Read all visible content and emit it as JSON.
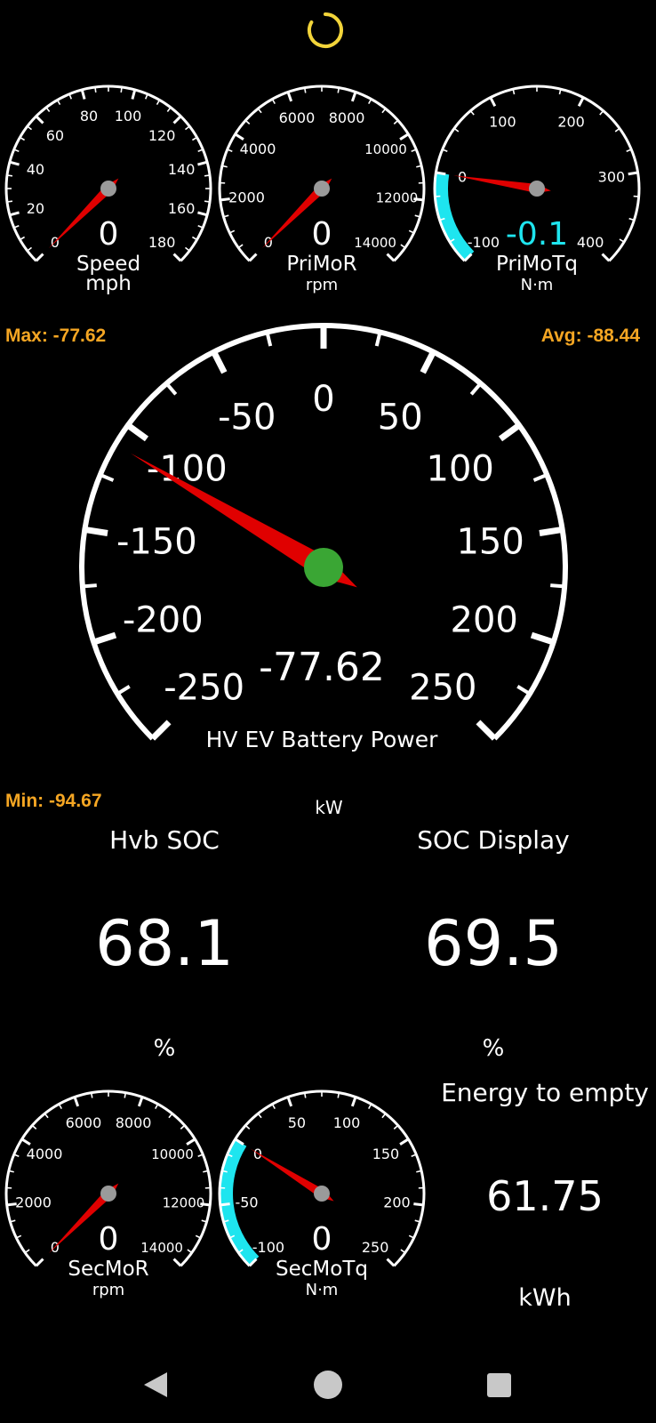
{
  "colors": {
    "needle": "#e00000",
    "hub_small": "#9a9a9a",
    "hub_big": "#3aa634",
    "accent_cyan": "#1ee5ef",
    "stats": "#f5a623",
    "spinner": "#f2d43a",
    "nav": "#c8c8c8"
  },
  "gauges_top": [
    {
      "id": "speed",
      "labels": [
        "0",
        "20",
        "40",
        "60",
        "80",
        "100",
        "120",
        "140",
        "160",
        "180"
      ],
      "min": 0,
      "max": 180,
      "value": 0,
      "value_text": "0",
      "name": "Speed",
      "unit": "mph"
    },
    {
      "id": "primor",
      "labels": [
        "0",
        "2000",
        "4000",
        "6000",
        "8000",
        "10000",
        "12000",
        "14000"
      ],
      "min": 0,
      "max": 14000,
      "value": 0,
      "value_text": "0",
      "name": "PriMoR",
      "unit": "rpm"
    },
    {
      "id": "primotq",
      "labels": [
        "-100",
        "0",
        "100",
        "200",
        "300",
        "400"
      ],
      "min": -100,
      "max": 400,
      "value": -0.1,
      "value_text": "-0.1",
      "name": "PriMoTq",
      "unit": "N·m",
      "cyan_range": [
        -100,
        0
      ]
    }
  ],
  "stats": {
    "max": "Max: -77.62",
    "avg": "Avg: -88.44",
    "min": "Min: -94.67"
  },
  "main_gauge": {
    "labels": [
      "-250",
      "-200",
      "-150",
      "-100",
      "-50",
      "0",
      "50",
      "100",
      "150",
      "200",
      "250"
    ],
    "min": -250,
    "max": 250,
    "value": -110,
    "value_text": "-77.62",
    "name": "HV EV Battery Power",
    "unit": "kW"
  },
  "tiles": {
    "hvb_soc": {
      "title": "Hvb SOC",
      "value": "68.1",
      "unit": "%"
    },
    "soc_display": {
      "title": "SOC Display",
      "value": "69.5",
      "unit": "%"
    },
    "energy": {
      "title": "Energy to empty",
      "value": "61.75",
      "unit": "kWh"
    }
  },
  "gauges_bottom": [
    {
      "id": "secmor",
      "labels": [
        "0",
        "2000",
        "4000",
        "6000",
        "8000",
        "10000",
        "12000",
        "14000"
      ],
      "min": 0,
      "max": 14000,
      "value": 0,
      "value_text": "0",
      "name": "SecMoR",
      "unit": "rpm"
    },
    {
      "id": "secmotq",
      "labels": [
        "-100",
        "-50",
        "0",
        "50",
        "100",
        "150",
        "200",
        "250"
      ],
      "min": -100,
      "max": 250,
      "value": 0,
      "value_text": "0",
      "name": "SecMoTq",
      "unit": "N·m",
      "cyan_range": [
        -100,
        0
      ]
    }
  ],
  "nav": {
    "back": "back-icon",
    "home": "home-icon",
    "recents": "recents-icon"
  }
}
